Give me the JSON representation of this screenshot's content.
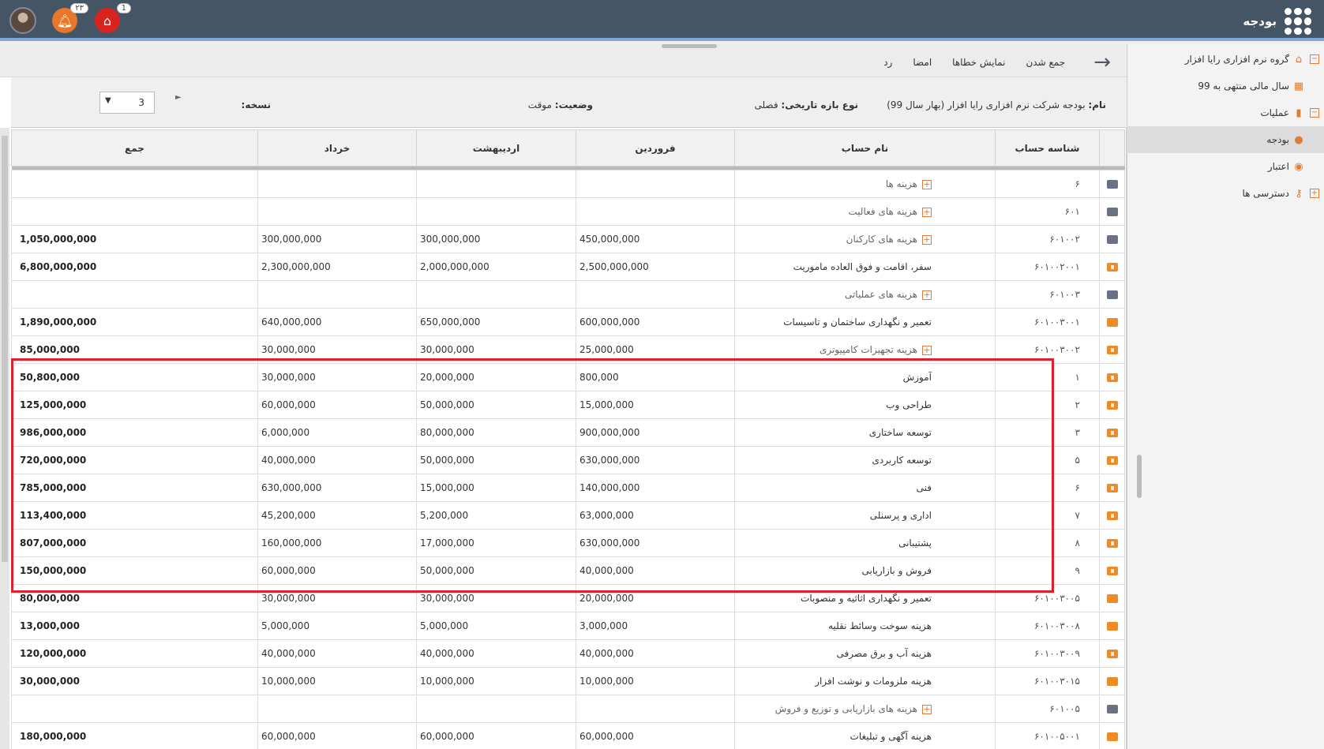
{
  "header": {
    "app_title": "بودجه",
    "notif_orange_count": "۲۳",
    "notif_red_count": "1"
  },
  "sidebar": {
    "items": [
      {
        "label": "گروه نرم افزاری رایا افزار",
        "icon": "building-icon"
      },
      {
        "label": "سال مالی منتهی به 99",
        "icon": "calendar-icon"
      },
      {
        "label": "عملیات",
        "icon": "chart-icon"
      },
      {
        "label": "بودجه",
        "icon": "money-bag-icon"
      },
      {
        "label": "اعتبار",
        "icon": "coins-icon"
      },
      {
        "label": "دسترسی ها",
        "icon": "key-icon"
      }
    ]
  },
  "toolbar": {
    "collect": "جمع شدن",
    "show_errors": "نمایش خطاها",
    "sign": "امضا",
    "reject": "رد"
  },
  "info": {
    "name_label": "نام:",
    "name_value": "بودجه شرکت نرم افزاری رایا افزار (بهار سال 99)",
    "period_label": "نوع بازه تاریخی:",
    "period_value": "فصلی",
    "status_label": "وضعیت:",
    "status_value": "موقت",
    "copy_label": "نسخه:",
    "copy_value": "3"
  },
  "table": {
    "headers": {
      "account_id": "شناسه حساب",
      "account_name": "نام حساب",
      "farvardin": "فروردین",
      "ordibehesht": "اردیبهشت",
      "khordad": "خرداد",
      "total": "جمع"
    },
    "rows": [
      {
        "icon": "gray",
        "id": "۶",
        "name": "هزینه ها",
        "expand": true,
        "m1": "",
        "m2": "",
        "m3": "",
        "total": ""
      },
      {
        "icon": "gray",
        "id": "۶۰۱",
        "name": "هزینه های فعالیت",
        "expand": true,
        "m1": "",
        "m2": "",
        "m3": "",
        "total": ""
      },
      {
        "icon": "gray",
        "id": "۶۰۱۰۰۲",
        "name": "هزینه های کارکنان",
        "expand": true,
        "m1": "450,000,000",
        "m2": "300,000,000",
        "m3": "300,000,000",
        "total": "1,050,000,000"
      },
      {
        "icon": "acc",
        "id": "۶۰۱۰۰۲۰۰۱",
        "name": "سفر، اقامت و فوق العاده ماموریت",
        "expand": false,
        "m1": "2,500,000,000",
        "m2": "2,000,000,000",
        "m3": "2,300,000,000",
        "total": "6,800,000,000"
      },
      {
        "icon": "gray",
        "id": "۶۰۱۰۰۳",
        "name": "هزینه های عملیاتی",
        "expand": true,
        "m1": "",
        "m2": "",
        "m3": "",
        "total": ""
      },
      {
        "icon": "orange",
        "id": "۶۰۱۰۰۳۰۰۱",
        "name": "تعمیر و نگهداری ساختمان و تاسیسات",
        "expand": false,
        "m1": "600,000,000",
        "m2": "650,000,000",
        "m3": "640,000,000",
        "total": "1,890,000,000"
      },
      {
        "icon": "acc",
        "id": "۶۰۱۰۰۳۰۰۲",
        "name": "هزینه تجهیزات کامپیوتری",
        "expand": true,
        "m1": "25,000,000",
        "m2": "30,000,000",
        "m3": "30,000,000",
        "total": "85,000,000"
      },
      {
        "icon": "acc",
        "id": "۱",
        "name": "آموزش",
        "expand": false,
        "m1": "800,000",
        "m2": "20,000,000",
        "m3": "30,000,000",
        "total": "50,800,000"
      },
      {
        "icon": "acc",
        "id": "۲",
        "name": "طراحی وب",
        "expand": false,
        "m1": "15,000,000",
        "m2": "50,000,000",
        "m3": "60,000,000",
        "total": "125,000,000"
      },
      {
        "icon": "acc",
        "id": "۳",
        "name": "توسعه ساختاری",
        "expand": false,
        "m1": "900,000,000",
        "m2": "80,000,000",
        "m3": "6,000,000",
        "total": "986,000,000"
      },
      {
        "icon": "acc",
        "id": "۵",
        "name": "توسعه کاربردی",
        "expand": false,
        "m1": "630,000,000",
        "m2": "50,000,000",
        "m3": "40,000,000",
        "total": "720,000,000"
      },
      {
        "icon": "acc",
        "id": "۶",
        "name": "فنی",
        "expand": false,
        "m1": "140,000,000",
        "m2": "15,000,000",
        "m3": "630,000,000",
        "total": "785,000,000"
      },
      {
        "icon": "acc",
        "id": "۷",
        "name": "اداری و پرسنلی",
        "expand": false,
        "m1": "63,000,000",
        "m2": "5,200,000",
        "m3": "45,200,000",
        "total": "113,400,000"
      },
      {
        "icon": "acc",
        "id": "۸",
        "name": "پشتیبانی",
        "expand": false,
        "m1": "630,000,000",
        "m2": "17,000,000",
        "m3": "160,000,000",
        "total": "807,000,000"
      },
      {
        "icon": "acc",
        "id": "۹",
        "name": "فروش و بازاریابی",
        "expand": false,
        "m1": "40,000,000",
        "m2": "50,000,000",
        "m3": "60,000,000",
        "total": "150,000,000"
      },
      {
        "icon": "orange",
        "id": "۶۰۱۰۰۳۰۰۵",
        "name": "تعمیر و نگهداری اثاثیه و منصوبات",
        "expand": false,
        "m1": "20,000,000",
        "m2": "30,000,000",
        "m3": "30,000,000",
        "total": "80,000,000"
      },
      {
        "icon": "orange",
        "id": "۶۰۱۰۰۳۰۰۸",
        "name": "هزینه سوخت وسائط نقلیه",
        "expand": false,
        "m1": "3,000,000",
        "m2": "5,000,000",
        "m3": "5,000,000",
        "total": "13,000,000"
      },
      {
        "icon": "acc",
        "id": "۶۰۱۰۰۳۰۰۹",
        "name": "هزینه آب و برق مصرفی",
        "expand": false,
        "m1": "40,000,000",
        "m2": "40,000,000",
        "m3": "40,000,000",
        "total": "120,000,000"
      },
      {
        "icon": "orange",
        "id": "۶۰۱۰۰۳۰۱۵",
        "name": "هزینه ملزومات و نوشت افزار",
        "expand": false,
        "m1": "10,000,000",
        "m2": "10,000,000",
        "m3": "10,000,000",
        "total": "30,000,000"
      },
      {
        "icon": "gray",
        "id": "۶۰۱۰۰۵",
        "name": "هزینه های بازاریابی و توزیع و فروش",
        "expand": true,
        "m1": "",
        "m2": "",
        "m3": "",
        "total": ""
      },
      {
        "icon": "orange",
        "id": "۶۰۱۰۰۵۰۰۱",
        "name": "هزینه آگهی و تبلیغات",
        "expand": false,
        "m1": "60,000,000",
        "m2": "60,000,000",
        "m3": "60,000,000",
        "total": "180,000,000"
      }
    ]
  },
  "colors": {
    "topbar": "#445566",
    "accent_orange": "#f08a24",
    "highlight_red": "#e0202a"
  }
}
